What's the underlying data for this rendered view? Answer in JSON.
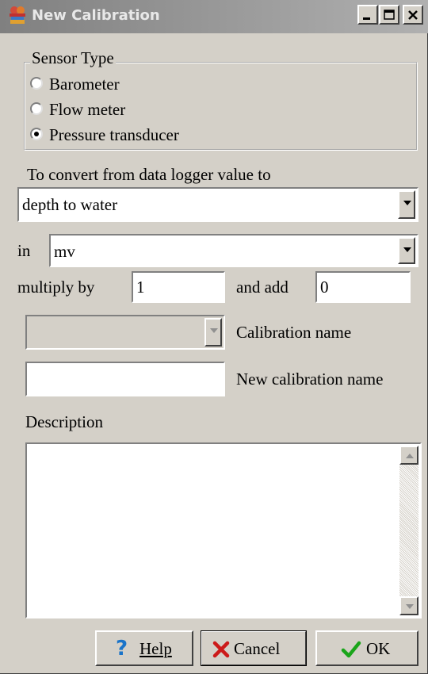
{
  "window": {
    "title": "New Calibration",
    "icon": "calibration-app-icon",
    "controls": [
      "minimize-icon",
      "maximize-icon",
      "close-icon"
    ]
  },
  "sensor_type": {
    "legend": "Sensor Type",
    "options": [
      {
        "label": "Barometer",
        "selected": false
      },
      {
        "label": "Flow meter",
        "selected": false
      },
      {
        "label": "Pressure transducer",
        "selected": true
      }
    ]
  },
  "convert": {
    "label": "To convert from data logger value to",
    "selected": "depth to water"
  },
  "unit": {
    "label": "in",
    "selected": "mv"
  },
  "formula": {
    "multiply_label": "multiply by",
    "multiply_value": "1",
    "add_label": "and add",
    "add_value": "0"
  },
  "calibration": {
    "name_label": "Calibration name",
    "name_value": "",
    "new_name_label": "New calibration name",
    "new_name_value": ""
  },
  "description": {
    "label": "Description",
    "value": ""
  },
  "buttons": {
    "help": {
      "label": "Help",
      "icon": "question-mark-icon",
      "color": "#1a74c9"
    },
    "cancel": {
      "label": "Cancel",
      "icon": "red-x-icon",
      "color": "#cc1a1a"
    },
    "ok": {
      "label": "OK",
      "icon": "green-check-icon",
      "color": "#1aa51a"
    }
  },
  "colors": {
    "dialog_bg": "#d4d0c8",
    "titlebar": "#808080"
  }
}
